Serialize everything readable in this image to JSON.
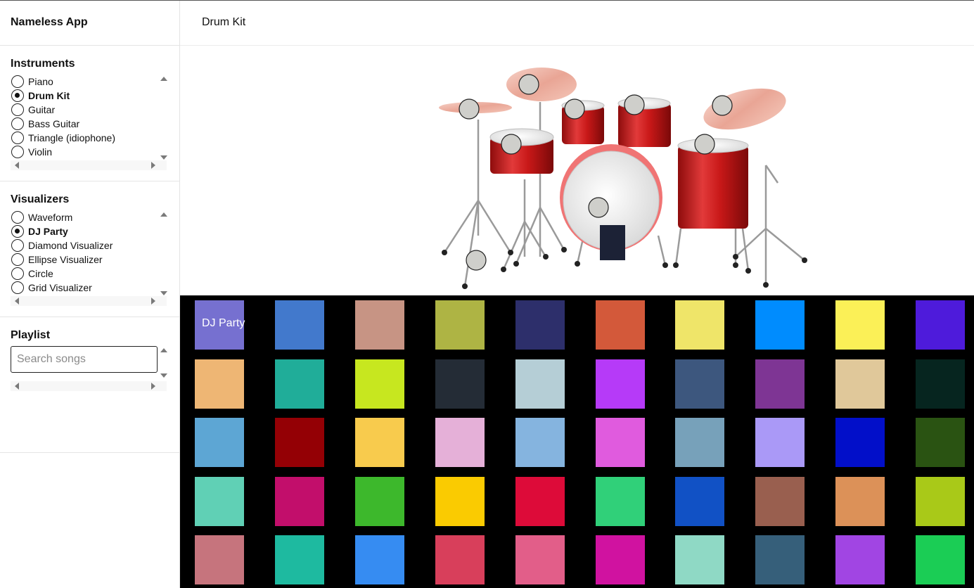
{
  "app": {
    "title": "Nameless App"
  },
  "header": {
    "title": "Drum Kit"
  },
  "instruments": {
    "heading": "Instruments",
    "items": [
      {
        "label": "Piano",
        "checked": false
      },
      {
        "label": "Drum Kit",
        "checked": true
      },
      {
        "label": "Guitar",
        "checked": false
      },
      {
        "label": "Bass Guitar",
        "checked": false
      },
      {
        "label": "Triangle (idiophone)",
        "checked": false
      },
      {
        "label": "Violin",
        "checked": false
      }
    ]
  },
  "visualizers": {
    "heading": "Visualizers",
    "items": [
      {
        "label": "Waveform",
        "checked": false
      },
      {
        "label": "DJ Party",
        "checked": true
      },
      {
        "label": "Diamond Visualizer",
        "checked": false
      },
      {
        "label": "Ellipse Visualizer",
        "checked": false
      },
      {
        "label": "Circle",
        "checked": false
      },
      {
        "label": "Grid Visualizer",
        "checked": false
      }
    ]
  },
  "playlist": {
    "heading": "Playlist",
    "placeholder": "Search songs"
  },
  "visualizer_label": "DJ Party",
  "grid_colors": [
    [
      "#7670d0",
      "#4279cc",
      "#c79484",
      "#aeb444",
      "#2d2f6b",
      "#d3593a",
      "#efe569",
      "#008cfe",
      "#fbf057",
      "#4e1bdb"
    ],
    [
      "#eeb674",
      "#20ad99",
      "#c7e71f",
      "#242c36",
      "#b5ced6",
      "#b63af8",
      "#3d577e",
      "#7e3594",
      "#e0c89a",
      "#06251f"
    ],
    [
      "#5da6d4",
      "#940005",
      "#f8cb4d",
      "#e5b0d8",
      "#85b4df",
      "#e05bde",
      "#77a1ba",
      "#aa99f7",
      "#020fc9",
      "#2a5312"
    ],
    [
      "#60d0b5",
      "#c20e6b",
      "#3db82c",
      "#facb01",
      "#dd0b39",
      "#30d079",
      "#1151c5",
      "#995f4f",
      "#dc9158",
      "#a9c918"
    ],
    [
      "#c6747d",
      "#1ebaa0",
      "#368cf2",
      "#d83f5b",
      "#e25e89",
      "#d012a0",
      "#8fd9c5",
      "#365f7a",
      "#a145e3",
      "#1bcd55"
    ]
  ]
}
